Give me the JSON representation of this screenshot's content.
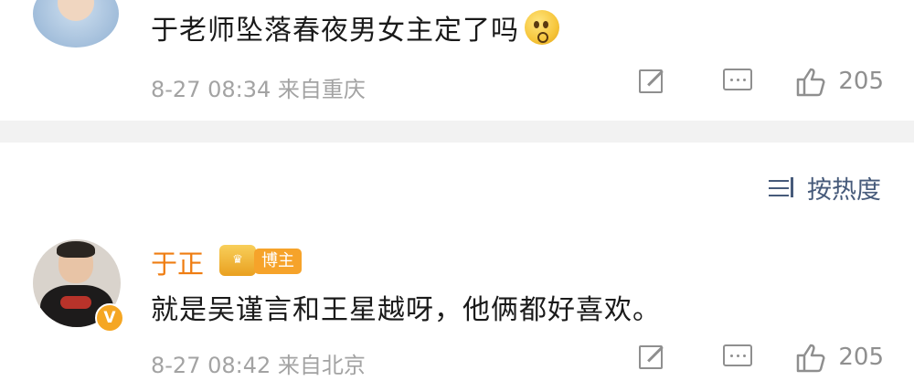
{
  "comments": [
    {
      "text": "于老师坠落春夜男女主定了吗",
      "emoji": "doge-question-emoji",
      "date": "8-27 08:34",
      "location": "来自重庆",
      "likes": "205"
    },
    {
      "username": "于正",
      "tag": "博主",
      "verified_badge": "V",
      "text": "就是吴谨言和王星越呀，他俩都好喜欢。",
      "date": "8-27 08:42",
      "location": "来自北京",
      "likes": "205"
    }
  ],
  "sort": {
    "label": "按热度"
  },
  "colors": {
    "username": "#ef7d12",
    "tag_bg": "#f6a32a",
    "sort": "#465a7a",
    "meta": "#a3a3a3"
  },
  "icons": {
    "share": "share-icon",
    "comment": "comment-icon",
    "like": "thumbs-up-icon",
    "sort": "sort-icon"
  }
}
